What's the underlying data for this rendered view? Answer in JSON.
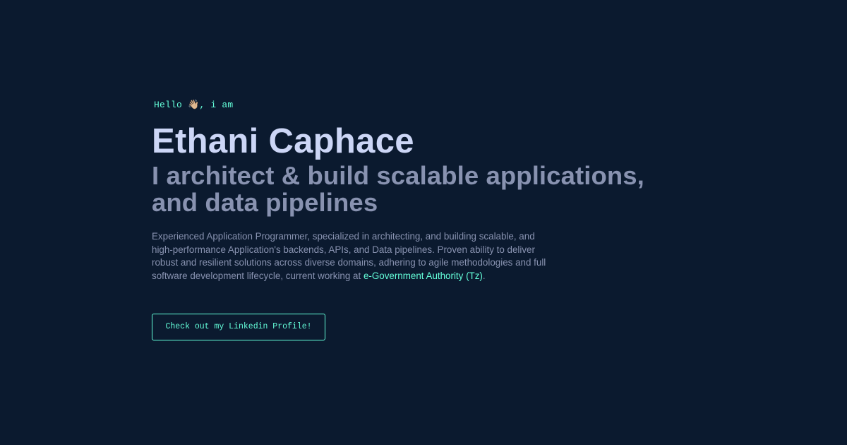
{
  "hero": {
    "greeting": "Hello",
    "greeting_emoji": "👋🏼",
    "greeting_suffix": ", i am",
    "name": "Ethani Caphace",
    "tagline_line1": "I architect & build scalable applications,",
    "tagline_line2": "and data pipelines",
    "bio_line1": "Experienced Application Programmer, specialized in architecting, and building scalable, and",
    "bio_line2": "high-performance Application's backends, APIs, and Data pipelines. Proven ability to deliver",
    "bio_line3": "robust and resilient solutions across diverse domains, adhering to agile methodologies and full",
    "bio_line4_prefix": "software development lifecycle, current working at ",
    "employer_link": "e-Government Authority (Tz)",
    "bio_line4_suffix": ".",
    "cta_label": "Check out my Linkedin Profile!"
  },
  "colors": {
    "background": "#0b1a2f",
    "accent": "#64ffda",
    "heading": "#ccd6f6",
    "muted": "#8892b0"
  },
  "icons": {
    "greeting_emoji": "waving-hand-icon"
  }
}
